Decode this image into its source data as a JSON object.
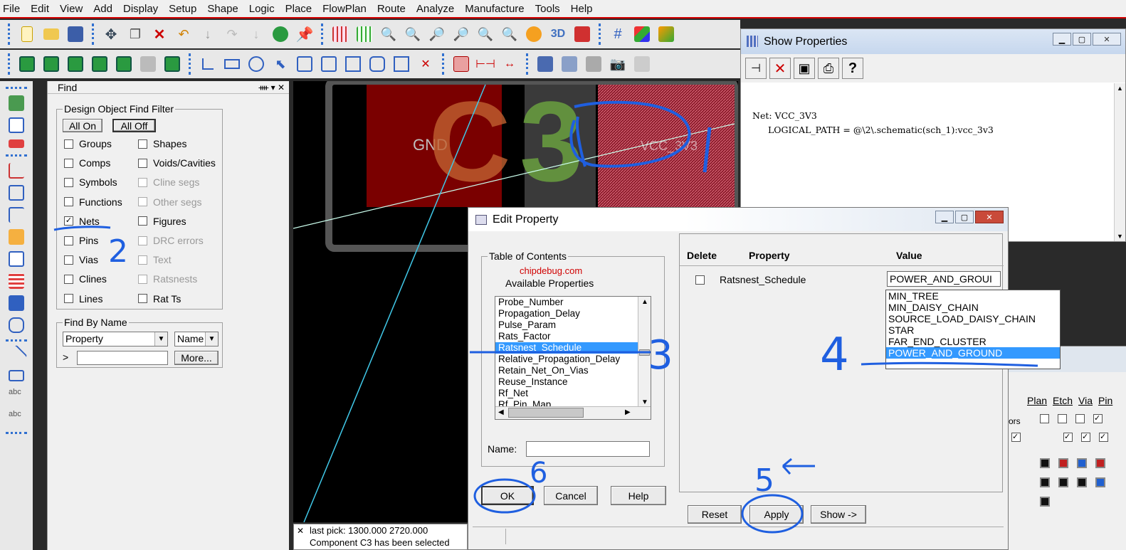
{
  "menubar": {
    "items": [
      "File",
      "Edit",
      "View",
      "Add",
      "Display",
      "Setup",
      "Shape",
      "Logic",
      "Place",
      "FlowPlan",
      "Route",
      "Analyze",
      "Manufacture",
      "Tools",
      "Help"
    ]
  },
  "find_panel": {
    "title": "Find",
    "filter_group": "Design Object Find Filter",
    "all_on": "All On",
    "all_off": "All Off",
    "left_checks": [
      {
        "label": "Groups",
        "checked": false
      },
      {
        "label": "Comps",
        "checked": false
      },
      {
        "label": "Symbols",
        "checked": false
      },
      {
        "label": "Functions",
        "checked": false
      },
      {
        "label": "Nets",
        "checked": true
      },
      {
        "label": "Pins",
        "checked": false
      },
      {
        "label": "Vias",
        "checked": false
      },
      {
        "label": "Clines",
        "checked": false
      },
      {
        "label": "Lines",
        "checked": false
      }
    ],
    "right_checks": [
      {
        "label": "Shapes",
        "enabled": true
      },
      {
        "label": "Voids/Cavities",
        "enabled": true
      },
      {
        "label": "Cline segs",
        "enabled": false
      },
      {
        "label": "Other segs",
        "enabled": false
      },
      {
        "label": "Figures",
        "enabled": true
      },
      {
        "label": "DRC errors",
        "enabled": false
      },
      {
        "label": "Text",
        "enabled": false
      },
      {
        "label": "Ratsnests",
        "enabled": false
      },
      {
        "label": "Rat Ts",
        "enabled": true
      }
    ],
    "find_by_name": "Find By Name",
    "type_value": "Property",
    "mode_value": "Name",
    "prompt": ">",
    "more": "More..."
  },
  "canvas": {
    "gnd_label": "GND",
    "ref_c": "C",
    "ref_3": "3",
    "vcc_label": "VCC_3V3"
  },
  "status": {
    "close": "✕",
    "line1": "last pick:  1300.000  2720.000",
    "line2": "Component C3 has been selected"
  },
  "show_properties": {
    "title": "Show Properties",
    "net_line": "Net: VCC_3V3",
    "path_line": "LOGICAL_PATH = @\\2\\.schematic(sch_1):vcc_3v3"
  },
  "edit_property": {
    "title": "Edit Property",
    "toc_group": "Table of Contents",
    "watermark": "chipdebug.com",
    "available_label": "Available Properties",
    "available": [
      "Probe_Number",
      "Propagation_Delay",
      "Pulse_Param",
      "Rats_Factor",
      "Ratsnest_Schedule",
      "Relative_Propagation_Delay",
      "Retain_Net_On_Vias",
      "Reuse_Instance",
      "Rf_Net",
      "Rf_Pin_Map"
    ],
    "selected_index": 4,
    "name_label": "Name:",
    "ok": "OK",
    "cancel": "Cancel",
    "help": "Help",
    "col_delete": "Delete",
    "col_property": "Property",
    "col_value": "Value",
    "property_name": "Ratsnest_Schedule",
    "value_text": "POWER_AND_GROUI",
    "value_options": [
      "MIN_TREE",
      "MIN_DAISY_CHAIN",
      "SOURCE_LOAD_DAISY_CHAIN",
      "STAR",
      "FAR_END_CLUSTER",
      "POWER_AND_GROUND"
    ],
    "value_selected": 5,
    "reset": "Reset",
    "apply": "Apply",
    "show": "Show ->"
  },
  "bg_panel": {
    "cols": [
      "Plan",
      "Etch",
      "Via",
      "Pin"
    ],
    "partial": "ors"
  },
  "annotations": [
    "1",
    "2",
    "3",
    "4",
    "5",
    "6"
  ],
  "colors": {
    "accent": "#3399ff",
    "pen": "#1f5fe0",
    "menu_red": "#d40000"
  }
}
